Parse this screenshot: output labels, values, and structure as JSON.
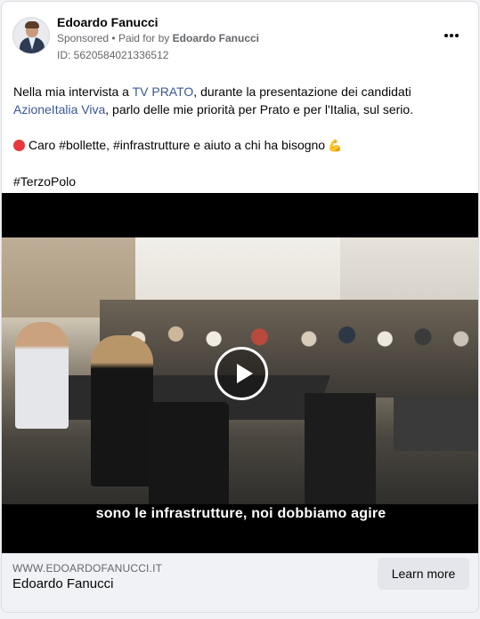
{
  "post": {
    "page_name": "Edoardo Fanucci",
    "sponsored": "Sponsored",
    "paid_for_prefix": "Paid for by",
    "paid_for_name": "Edoardo Fanucci",
    "separator": "•",
    "ad_id": "ID: 5620584021336512"
  },
  "text": {
    "line1_a": "Nella mia intervista a ",
    "line1_link": "TV PRATO",
    "line1_b": ", durante la presentazione dei candidati",
    "line2_link": "AzioneItalia Viva",
    "line2_b": ", parlo delle mie priorità per Prato e per l'Italia, sul serio.",
    "line3": "Caro #bollette, #infrastrutture e aiuto a chi ha bisogno",
    "line3_emoji": "💪",
    "hashtag": "#TerzoPolo"
  },
  "video": {
    "caption": "sono le infrastrutture, noi dobbiamo agire"
  },
  "footer": {
    "domain": "WWW.EDOARDOFANUCCI.IT",
    "title": "Edoardo Fanucci",
    "cta": "Learn more"
  },
  "colors": {
    "link": "#385898",
    "muted": "#65676b",
    "footer_bg": "#f0f2f5",
    "cta_bg": "#e4e6eb"
  },
  "icons": [
    "avatar-photo",
    "more-options-icon",
    "red-circle-emoji",
    "flexed-biceps-emoji",
    "play-icon"
  ]
}
